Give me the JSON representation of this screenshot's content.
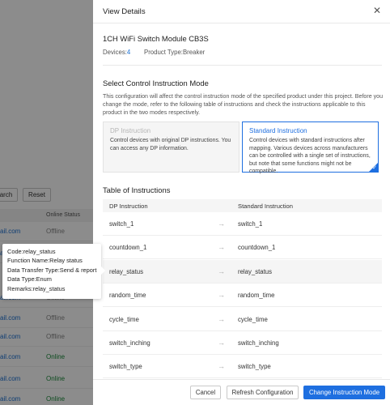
{
  "background": {
    "search_label": "arch",
    "reset_label": "Reset",
    "online_status_header": "Online Status",
    "rows": [
      {
        "email": "ail.com",
        "status": "Offline"
      },
      {
        "email": "ail.com",
        "status": "Offline"
      },
      {
        "email": "ail.com",
        "status": "Offline"
      },
      {
        "email": "ail.com",
        "status": "Offline"
      },
      {
        "email": "ail.com",
        "status": "Offline"
      },
      {
        "email": "ail.com",
        "status": "Online"
      },
      {
        "email": "ail.com",
        "status": "Online"
      },
      {
        "email": "ail.com",
        "status": "Online"
      }
    ]
  },
  "tooltip": {
    "code": "Code:relay_status",
    "function_name": "Function Name:Relay status",
    "data_transfer": "Data Transfer Type:Send & report",
    "data_type": "Data Type:Enum",
    "remarks": "Remarks:relay_status"
  },
  "drawer": {
    "title": "View Details",
    "product_name": "1CH WiFi Switch Module CB3S",
    "devices_label": "Devices:",
    "devices_value": "4",
    "product_type_label": "Product Type:",
    "product_type_value": "Breaker",
    "mode_section_title": "Select Control Instruction Mode",
    "mode_description": "This configuration will affect the control instruction mode of the specified product under this project. Before you change the mode, refer to the following table of instructions and check the instructions applicable to this product in the two modes respectively.",
    "modes": [
      {
        "title": "DP Instruction",
        "desc": "Control devices with original DP instructions. You can access any DP information."
      },
      {
        "title": "Standard Instruction",
        "desc": "Control devices with standard instructions after mapping. Various devices across manufacturers can be controlled with a single set of instructions, but note that some functions might not be compatible."
      }
    ],
    "selected_mode": "Standard Instruction",
    "table_title": "Table of Instructions",
    "table_headers": [
      "DP Instruction",
      "Standard Instruction"
    ],
    "table_rows": [
      {
        "dp": "switch_1",
        "std": "switch_1"
      },
      {
        "dp": "countdown_1",
        "std": "countdown_1"
      },
      {
        "dp": "relay_status",
        "std": "relay_status"
      },
      {
        "dp": "random_time",
        "std": "random_time"
      },
      {
        "dp": "cycle_time",
        "std": "cycle_time"
      },
      {
        "dp": "switch_inching",
        "std": "switch_inching"
      },
      {
        "dp": "switch_type",
        "std": "switch_type"
      }
    ],
    "footer": {
      "cancel": "Cancel",
      "refresh": "Refresh Configuration",
      "change": "Change Instruction Mode"
    }
  },
  "colors": {
    "accent": "#1e6fe0",
    "online": "#1a8a3a",
    "offline": "#888888",
    "link": "#1a6fd1"
  }
}
